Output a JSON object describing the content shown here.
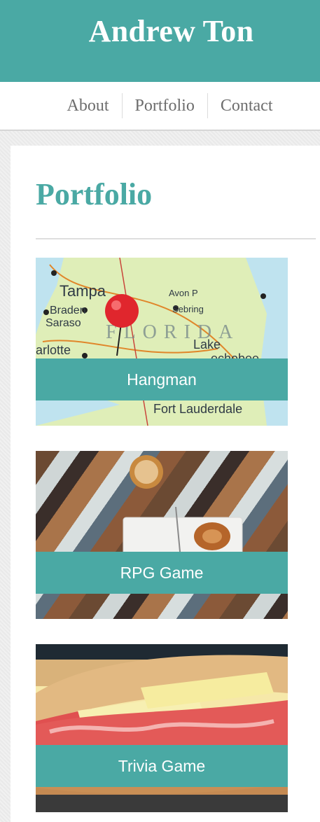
{
  "site": {
    "title": "Andrew Ton"
  },
  "nav": {
    "items": [
      "About",
      "Portfolio",
      "Contact"
    ]
  },
  "page": {
    "heading": "Portfolio"
  },
  "portfolio": [
    {
      "label": "Hangman",
      "image": "florida-map-pin-photo"
    },
    {
      "label": "RPG Game",
      "image": "coffee-on-wood-table-photo"
    },
    {
      "label": "Trivia Game",
      "image": "sandwich-photo"
    }
  ],
  "map_labels": [
    "Tampa",
    "Braden",
    "Saraso",
    "FLORIDA",
    "Lake",
    "arlotte",
    "Fort Lauderdale",
    "Sebring",
    "Avon P",
    "echobee"
  ],
  "colors": {
    "accent": "#4aa9a4",
    "nav_text": "#6d6d6d",
    "pin": "#e0262d"
  }
}
